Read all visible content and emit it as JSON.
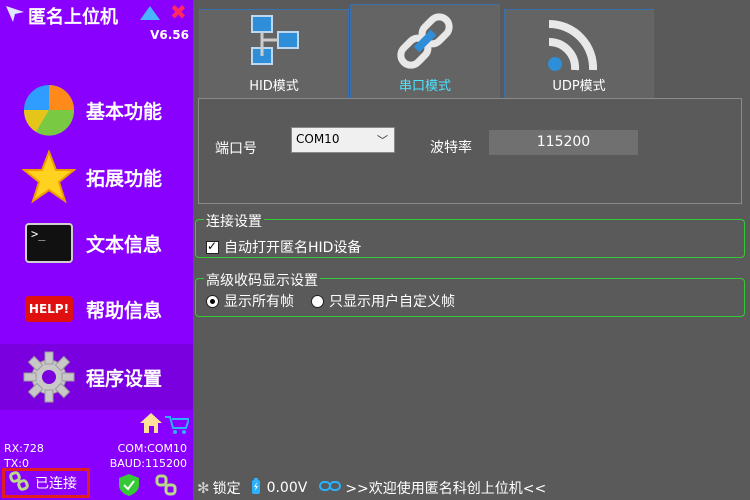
{
  "app": {
    "title": "匿名上位机",
    "version": "V6.56"
  },
  "menu": [
    {
      "label": "基本功能",
      "icon": "pie-chart-icon"
    },
    {
      "label": "拓展功能",
      "icon": "star-icon"
    },
    {
      "label": "文本信息",
      "icon": "terminal-icon",
      "icon_text": ">_"
    },
    {
      "label": "帮助信息",
      "icon": "help-icon",
      "icon_text": "HELP!"
    },
    {
      "label": "程序设置",
      "icon": "gear-icon"
    }
  ],
  "sidebar_status": {
    "rx": "RX:728",
    "tx": "TX:0",
    "com": "COM:COM10",
    "baud": "BAUD:115200",
    "connected": "已连接"
  },
  "tabs": [
    {
      "label": "HID模式",
      "icon": "network-icon"
    },
    {
      "label": "串口模式",
      "icon": "chain-link-icon"
    },
    {
      "label": "UDP模式",
      "icon": "wifi-icon"
    }
  ],
  "active_tab": "串口模式",
  "serial": {
    "port_label": "端口号",
    "port_value": "COM10",
    "baud_label": "波特率",
    "baud_value": "115200"
  },
  "connect_settings": {
    "title": "连接设置",
    "auto_open_label": "自动打开匿名HID设备",
    "auto_open_checked": true
  },
  "advanced_settings": {
    "title": "高级收码显示设置",
    "options": [
      "显示所有帧",
      "只显示用户自定义帧"
    ],
    "selected": "显示所有帧"
  },
  "statusbar": {
    "lock_label": "锁定",
    "voltage": "0.00V",
    "welcome": ">>欢迎使用匿名科创上位机<<"
  },
  "colors": {
    "sidebar": "#8a00ff",
    "main_bg": "#5a5a5a",
    "active_tab_text": "#4fe3ff",
    "group_border": "#35c935",
    "connect_highlight": "#e02020"
  }
}
